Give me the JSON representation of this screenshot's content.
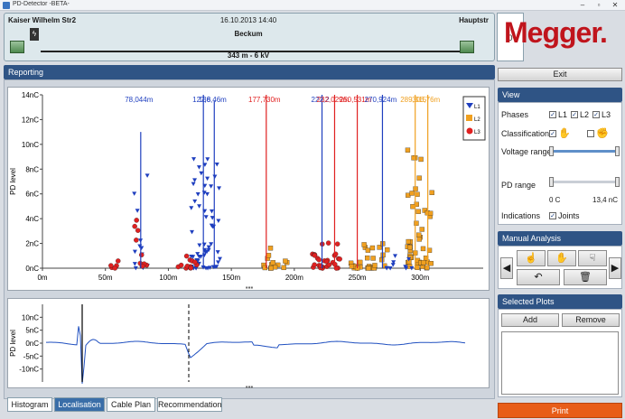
{
  "window": {
    "title": "PD-Detector -BETA-"
  },
  "cable": {
    "start": "Kaiser Wilhelm Str2",
    "end": "Hauptstr",
    "datetime": "16.10.2013 14:40",
    "site": "Beckum",
    "info": "343 m - 6 kV",
    "count": "0"
  },
  "logo": "Megger.",
  "reporting": {
    "title": "Reporting"
  },
  "tabs": [
    "Histogram",
    "Localisation",
    "Cable Plan",
    "Recommendation"
  ],
  "right": {
    "exit": "Exit",
    "view_title": "View",
    "phases_label": "Phases",
    "phases": [
      "L1",
      "L2",
      "L3"
    ],
    "classification_label": "Classification",
    "voltage_label": "Voltage range",
    "pd_label": "PD range",
    "pd_min": "0 C",
    "pd_max": "13,4 nC",
    "indications_label": "Indications",
    "joints_label": "Joints",
    "manual_title": "Manual Analysis",
    "selected_title": "Selected Plots",
    "add": "Add",
    "remove": "Remove",
    "print": "Print"
  },
  "colors": {
    "l1": "#1f3fbf",
    "l2": "#f0a020",
    "l3": "#e02020",
    "accent": "#2f5485"
  },
  "chart_data": [
    {
      "type": "scatter",
      "ylabel": "PD level",
      "ylim": [
        0,
        14
      ],
      "xlim": [
        0,
        350
      ],
      "y_ticks": [
        "0nC",
        "2nC",
        "4nC",
        "6nC",
        "8nC",
        "10nC",
        "12nC",
        "14nC"
      ],
      "x_ticks": [
        "0m",
        "50m",
        "100m",
        "150m",
        "200m",
        "250m",
        "300m"
      ],
      "legend": [
        "L1",
        "L2",
        "L3"
      ],
      "legend_position": "top-right",
      "markers": [
        {
          "x": 78.044,
          "label": "78,044m",
          "phase": "L1",
          "peak": 11.0
        },
        {
          "x": 127.8,
          "label": "127,8",
          "phase": "L1",
          "peak": 14.0
        },
        {
          "x": 136.46,
          "label": "136,46m",
          "phase": "L1",
          "peak": 13.5
        },
        {
          "x": 177.73,
          "label": "177,730m",
          "phase": "L3",
          "peak": 14.0
        },
        {
          "x": 222.0,
          "label": "222,2",
          "phase": "L1",
          "peak": 14.0
        },
        {
          "x": 232.0,
          "label": "232,029m",
          "phase": "L3",
          "peak": 14.0
        },
        {
          "x": 250.0,
          "label": "250,531m",
          "phase": "L3",
          "peak": 14.0
        },
        {
          "x": 270.0,
          "label": "270,924m",
          "phase": "L1",
          "peak": 14.0
        },
        {
          "x": 296.0,
          "label": "289,315",
          "phase": "L2",
          "peak": 14.0
        },
        {
          "x": 306.0,
          "label": "306,76m",
          "phase": "L2",
          "peak": 14.0
        }
      ],
      "clusters": [
        {
          "x": 78,
          "spread": 6,
          "phase": "L1",
          "count": 14,
          "max": 8
        },
        {
          "x": 80,
          "spread": 8,
          "phase": "L3",
          "count": 10,
          "max": 4
        },
        {
          "x": 58,
          "spread": 4,
          "phase": "L3",
          "count": 5,
          "max": 1.5
        },
        {
          "x": 130,
          "spread": 12,
          "phase": "L1",
          "count": 60,
          "max": 9
        },
        {
          "x": 115,
          "spread": 8,
          "phase": "L3",
          "count": 12,
          "max": 1
        },
        {
          "x": 185,
          "spread": 10,
          "phase": "L2",
          "count": 14,
          "max": 2
        },
        {
          "x": 225,
          "spread": 12,
          "phase": "L3",
          "count": 30,
          "max": 2.2
        },
        {
          "x": 260,
          "spread": 15,
          "phase": "L2",
          "count": 30,
          "max": 2
        },
        {
          "x": 300,
          "spread": 10,
          "phase": "L2",
          "count": 50,
          "max": 10
        },
        {
          "x": 285,
          "spread": 12,
          "phase": "L1",
          "count": 10,
          "max": 1
        }
      ]
    },
    {
      "type": "line",
      "ylabel": "PD level",
      "ylim": [
        -15,
        15
      ],
      "y_ticks": [
        "-10nC",
        "-5nC",
        "0nC",
        "5nC",
        "10nC"
      ],
      "series": [
        {
          "values": []
        }
      ]
    }
  ]
}
